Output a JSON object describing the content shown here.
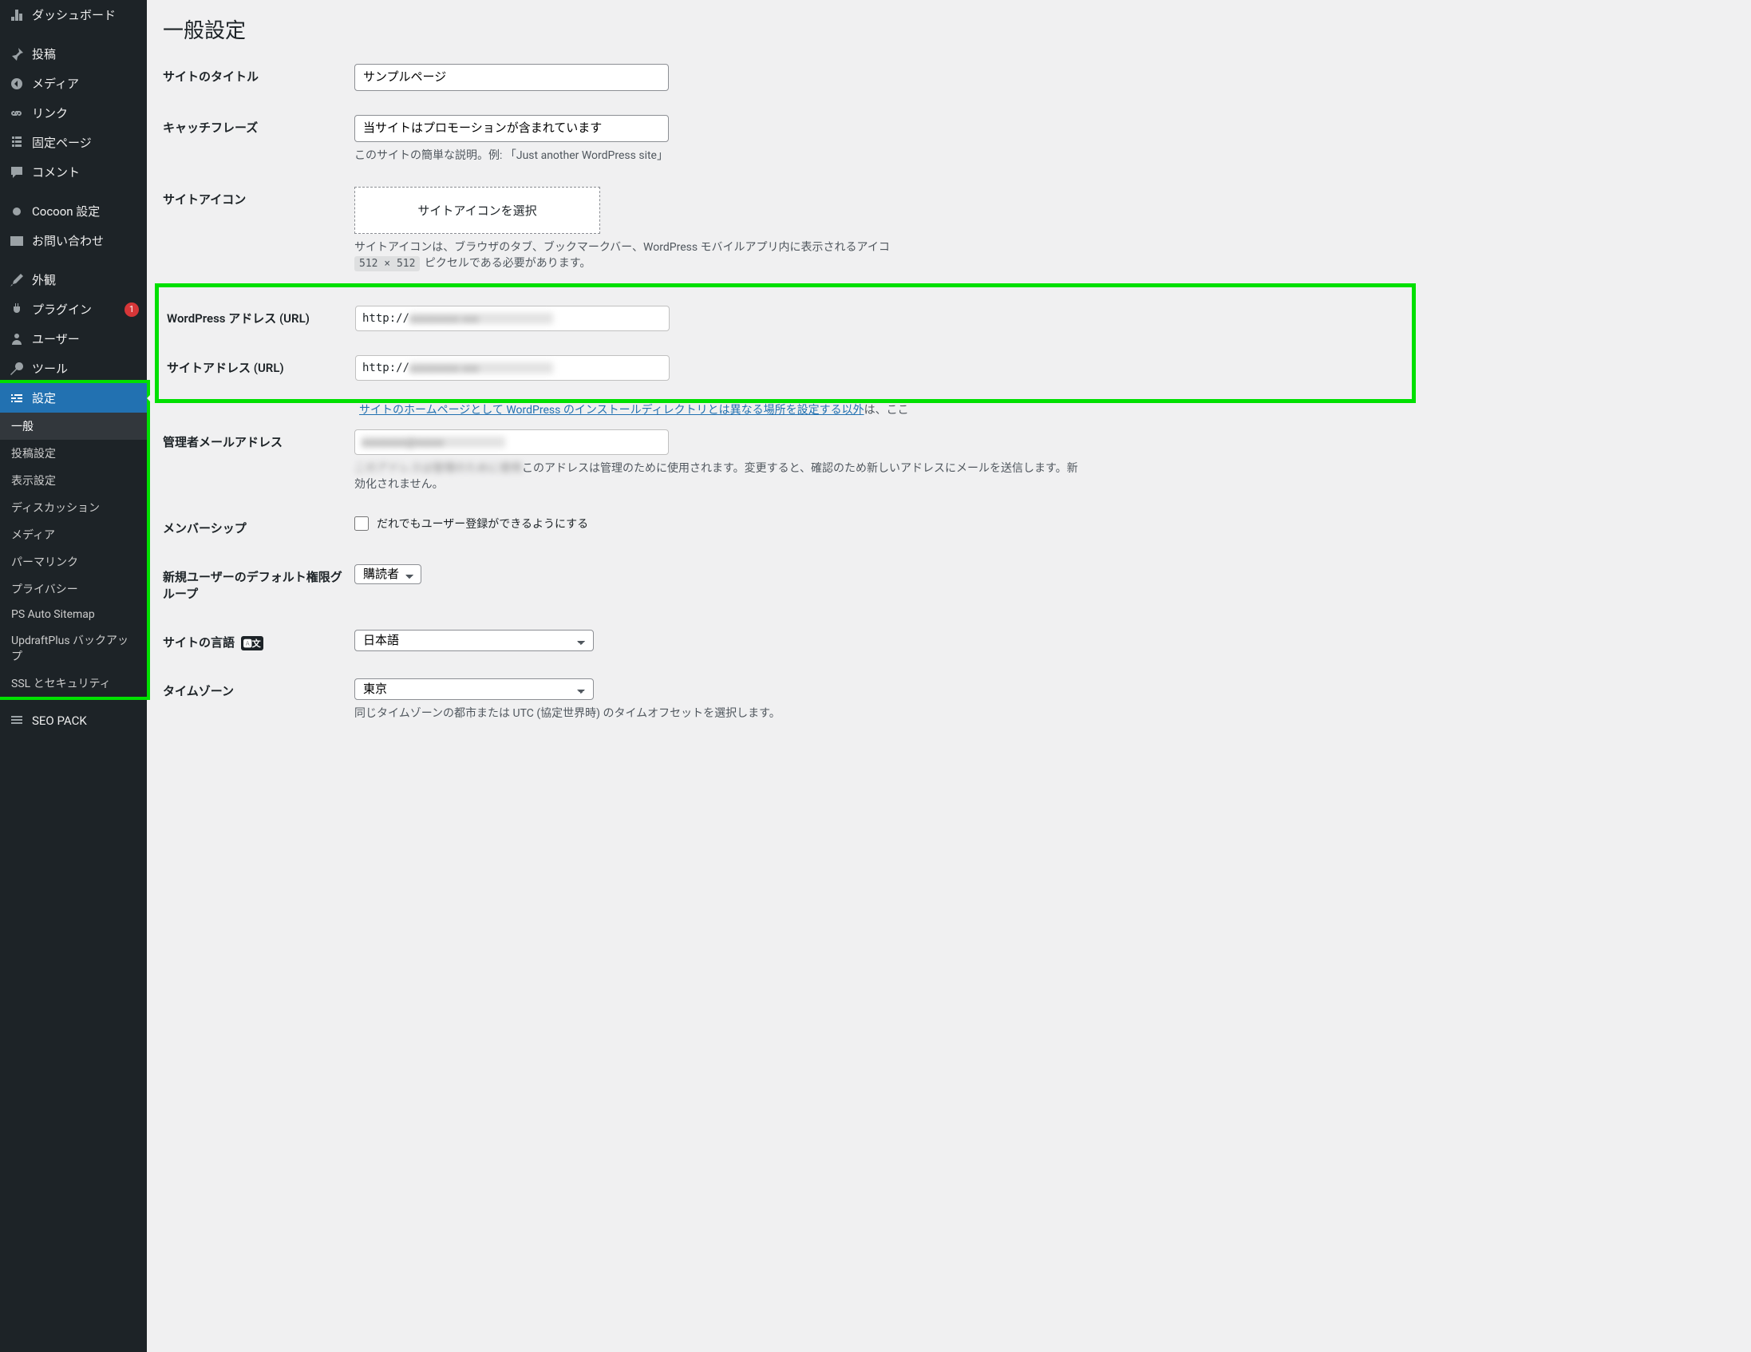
{
  "sidebar": {
    "items": [
      {
        "icon": "dashboard",
        "label": "ダッシュボード"
      },
      {
        "icon": "pin",
        "label": "投稿",
        "sep": true
      },
      {
        "icon": "media",
        "label": "メディア"
      },
      {
        "icon": "link",
        "label": "リンク"
      },
      {
        "icon": "page",
        "label": "固定ページ"
      },
      {
        "icon": "comment",
        "label": "コメント"
      },
      {
        "icon": "circle",
        "label": "Cocoon 設定",
        "sep": true
      },
      {
        "icon": "mail",
        "label": "お問い合わせ"
      },
      {
        "icon": "brush",
        "label": "外観",
        "sep": true
      },
      {
        "icon": "plugin",
        "label": "プラグイン",
        "badge": "1"
      },
      {
        "icon": "user",
        "label": "ユーザー"
      },
      {
        "icon": "tool",
        "label": "ツール"
      },
      {
        "icon": "settings",
        "label": "設定",
        "current": true
      },
      {
        "icon": "list",
        "label": "SEO PACK",
        "sep": true
      }
    ],
    "submenu": [
      {
        "label": "一般",
        "current": true
      },
      {
        "label": "投稿設定"
      },
      {
        "label": "表示設定"
      },
      {
        "label": "ディスカッション"
      },
      {
        "label": "メディア"
      },
      {
        "label": "パーマリンク"
      },
      {
        "label": "プライバシー"
      },
      {
        "label": "PS Auto Sitemap"
      },
      {
        "label": "UpdraftPlus バックアップ"
      },
      {
        "label": "SSL とセキュリティ"
      }
    ]
  },
  "page": {
    "title": "一般設定",
    "site_title": {
      "label": "サイトのタイトル",
      "value": "サンプルページ"
    },
    "tagline": {
      "label": "キャッチフレーズ",
      "value": "当サイトはプロモーションが含まれています",
      "desc": "このサイトの簡単な説明。例: 「Just another WordPress site」"
    },
    "site_icon": {
      "label": "サイトアイコン",
      "button": "サイトアイコンを選択",
      "desc_pre": "サイトアイコンは、ブラウザのタブ、ブックマークバー、WordPress モバイルアプリ内に表示されるアイコ",
      "size": "512 × 512",
      "desc_post": " ピクセルである必要があります。"
    },
    "wp_url": {
      "label": "WordPress アドレス (URL)",
      "value": "http://"
    },
    "site_url": {
      "label": "サイトアドレス (URL)",
      "value": "http://",
      "link": "サイトのホームページとして WordPress のインストールディレクトリとは異なる場所を設定する以外",
      "desc_post": "は、ここ"
    },
    "admin_email": {
      "label": "管理者メールアドレス",
      "desc": "このアドレスは管理のために使用されます。変更すると、確認のため新しいアドレスにメールを送信します。新",
      "desc2": "効化されません。"
    },
    "membership": {
      "label": "メンバーシップ",
      "checkbox": "だれでもユーザー登録ができるようにする"
    },
    "default_role": {
      "label": "新規ユーザーのデフォルト権限グループ",
      "value": "購読者"
    },
    "language": {
      "label": "サイトの言語",
      "value": "日本語"
    },
    "timezone": {
      "label": "タイムゾーン",
      "value": "東京",
      "desc": "同じタイムゾーンの都市または UTC (協定世界時) のタイムオフセットを選択します。"
    }
  }
}
